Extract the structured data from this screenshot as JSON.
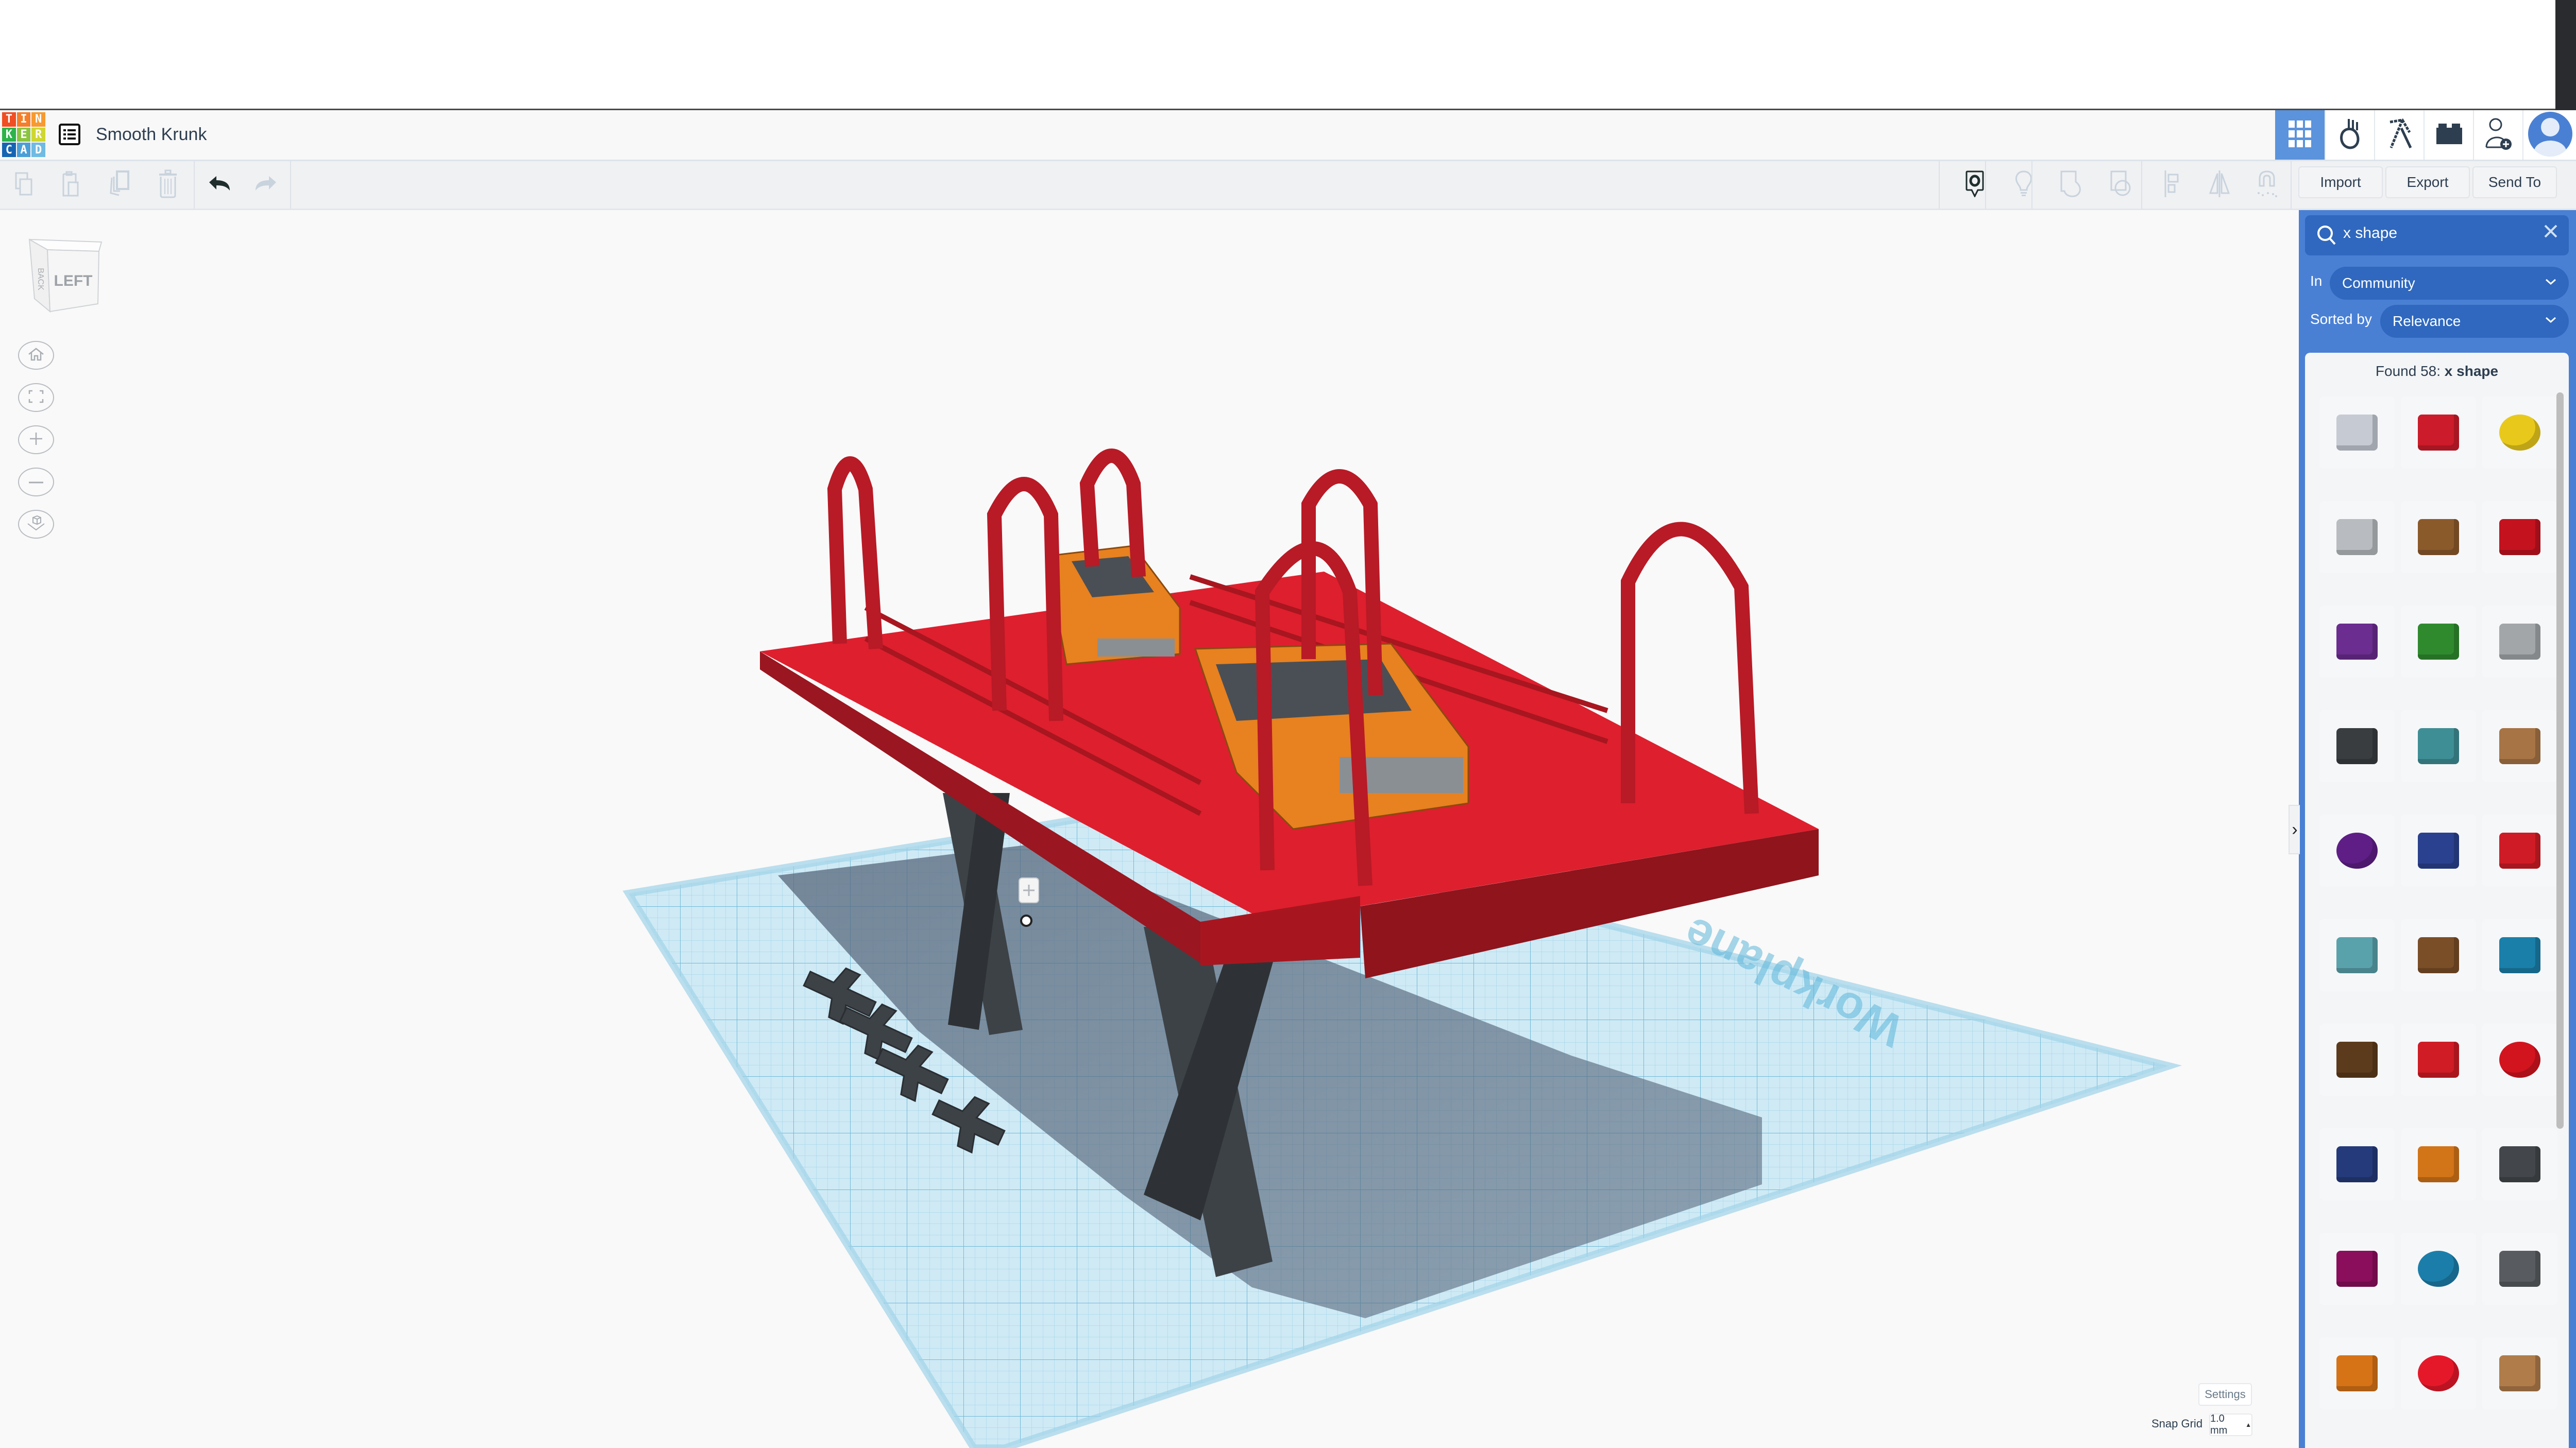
{
  "app": {
    "name": "Tinkercad",
    "logo_letters": [
      "T",
      "I",
      "N",
      "K",
      "E",
      "R",
      "C",
      "A",
      "D"
    ],
    "logo_colors": [
      "#f04e23",
      "#f47e2a",
      "#f79a2f",
      "#2db34a",
      "#8bc53f",
      "#cfd631",
      "#1565b3",
      "#4a9fd6",
      "#6fbbe3"
    ],
    "document_title": "Smooth Krunk"
  },
  "header": {
    "buttons": [
      {
        "name": "3d-design-view",
        "icon": "grid-icon",
        "active": true
      },
      {
        "name": "circuits-view",
        "icon": "apple-hand-icon",
        "active": false
      },
      {
        "name": "blocks-view",
        "icon": "pickaxe-icon",
        "active": false
      },
      {
        "name": "bricks-view",
        "icon": "brick-icon",
        "active": false
      },
      {
        "name": "invite-user",
        "icon": "add-user-icon",
        "active": false
      },
      {
        "name": "profile",
        "icon": "avatar-icon",
        "active": false
      }
    ]
  },
  "toolbar": {
    "left_tools": [
      {
        "name": "copy",
        "icon": "copy-icon",
        "enabled": false
      },
      {
        "name": "paste",
        "icon": "paste-icon",
        "enabled": false
      },
      {
        "name": "duplicate",
        "icon": "duplicate-icon",
        "enabled": false
      },
      {
        "name": "delete",
        "icon": "trash-icon",
        "enabled": false
      },
      {
        "name": "undo",
        "icon": "undo-icon",
        "enabled": true
      },
      {
        "name": "redo",
        "icon": "redo-icon",
        "enabled": false
      }
    ],
    "right_tools": [
      {
        "name": "notes",
        "icon": "note-bubble-icon",
        "enabled": true
      },
      {
        "name": "show-hidden",
        "icon": "lightbulb-icon",
        "enabled": false
      },
      {
        "name": "group",
        "icon": "group-icon",
        "enabled": false
      },
      {
        "name": "ungroup",
        "icon": "ungroup-icon",
        "enabled": false
      },
      {
        "name": "align",
        "icon": "align-icon",
        "enabled": false
      },
      {
        "name": "mirror",
        "icon": "mirror-icon",
        "enabled": false
      },
      {
        "name": "cruise",
        "icon": "magnet-icon",
        "enabled": false
      }
    ],
    "import_label": "Import",
    "export_label": "Export",
    "send_to_label": "Send To"
  },
  "viewport": {
    "view_cube_face": "LEFT",
    "view_cube_side": "BACK",
    "nav_buttons": [
      {
        "name": "home-view",
        "icon": "home-icon"
      },
      {
        "name": "fit-all",
        "icon": "fit-view-icon"
      },
      {
        "name": "zoom-in",
        "icon": "plus-icon"
      },
      {
        "name": "zoom-out",
        "icon": "minus-icon"
      },
      {
        "name": "perspective",
        "icon": "ortho-cube-icon"
      }
    ],
    "workplane_label": "Workplane",
    "scene_colors": {
      "platform": "#d91f2d",
      "platform_dark": "#8f141c",
      "legs": "#3d4247",
      "cars": "#e8811f",
      "workplane": "#bfe4f2"
    },
    "settings_label": "Settings",
    "snap_grid_label": "Snap Grid",
    "snap_grid_value": "1.0 mm"
  },
  "panel": {
    "search_value": "x shape",
    "in_label": "In",
    "in_value": "Community",
    "sorted_by_label": "Sorted by",
    "sorted_by_value": "Relevance",
    "found_prefix": "Found 58: ",
    "found_query": "x shape",
    "accent": "#4a80d4",
    "results": [
      {
        "name": "striped-box",
        "color": "#c5cad3"
      },
      {
        "name": "red-box",
        "color": "#cc1b2a"
      },
      {
        "name": "yellow-sphere",
        "color": "#e8c91b"
      },
      {
        "name": "grey-paraboloid",
        "color": "#b8bbbf"
      },
      {
        "name": "brown-knot",
        "color": "#8b5a2b"
      },
      {
        "name": "red-state-outline",
        "color": "#c4121f"
      },
      {
        "name": "purple-gem",
        "color": "#6b2d8f"
      },
      {
        "name": "green-wave",
        "color": "#2f8a2e"
      },
      {
        "name": "grey-gear",
        "color": "#a3a6a9"
      },
      {
        "name": "black-wave-wall",
        "color": "#3a3d40"
      },
      {
        "name": "teal-texture-plate",
        "color": "#3e8e95"
      },
      {
        "name": "tan-loop",
        "color": "#a77445"
      },
      {
        "name": "purple-dot-disc",
        "color": "#5e1e86"
      },
      {
        "name": "blue-star",
        "color": "#2a418f"
      },
      {
        "name": "red-spool",
        "color": "#cf1b25"
      },
      {
        "name": "teal-tile",
        "color": "#5aa2ab"
      },
      {
        "name": "brown-column",
        "color": "#7a4e27"
      },
      {
        "name": "blue-grid-tile",
        "color": "#1a7fa9"
      },
      {
        "name": "brown-plank",
        "color": "#5c3b1c"
      },
      {
        "name": "red-polyhedron",
        "color": "#cf1c25"
      },
      {
        "name": "red-torus",
        "color": "#d2141f"
      },
      {
        "name": "blue-x-pillar",
        "color": "#253a7a"
      },
      {
        "name": "orange-flower-pillar",
        "color": "#d27418"
      },
      {
        "name": "grey-star-pillar",
        "color": "#43474b"
      },
      {
        "name": "magenta-box",
        "color": "#8a0e5c"
      },
      {
        "name": "blue-ring",
        "color": "#1b7eaa"
      },
      {
        "name": "grey-x-shape",
        "color": "#585c60"
      },
      {
        "name": "orange-plane",
        "color": "#d67316"
      },
      {
        "name": "red-octagon",
        "color": "#e5182a"
      },
      {
        "name": "tan-x-block",
        "color": "#b07c4a"
      }
    ]
  }
}
